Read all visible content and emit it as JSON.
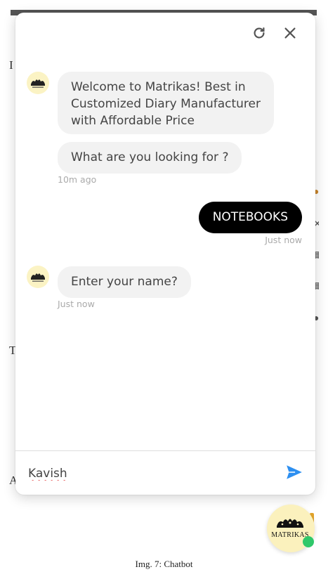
{
  "header": {
    "refresh_icon": "refresh-icon",
    "close_icon": "close-icon"
  },
  "messages": {
    "bot_welcome": "Welcome to Matrikas! Best in Customized Diary Manufacturer with Affordable Price",
    "bot_welcome_lines": [
      "Welcome to Matrikas! Best in",
      "Customized Diary Manufacturer",
      "with Affordable Price"
    ],
    "bot_question": "What are you looking for ?",
    "bot_question_time": "10m ago",
    "user_reply": "NOTEBOOKS",
    "user_reply_time": "Just now",
    "bot_name_prompt": "Enter your name?",
    "bot_name_prompt_time": "Just now"
  },
  "composer": {
    "value": "Kavish",
    "send_icon": "send-icon"
  },
  "launcher": {
    "brand_text": "MATRIKAS",
    "status": "online"
  },
  "caption": "Img. 7: Chatbot",
  "colors": {
    "user_bubble": "#000000",
    "bot_bubble": "#f2f2f2",
    "send_icon": "#2d8ff0",
    "online_dot": "#2fc86a",
    "avatar_bg": "#fbf3c4"
  }
}
